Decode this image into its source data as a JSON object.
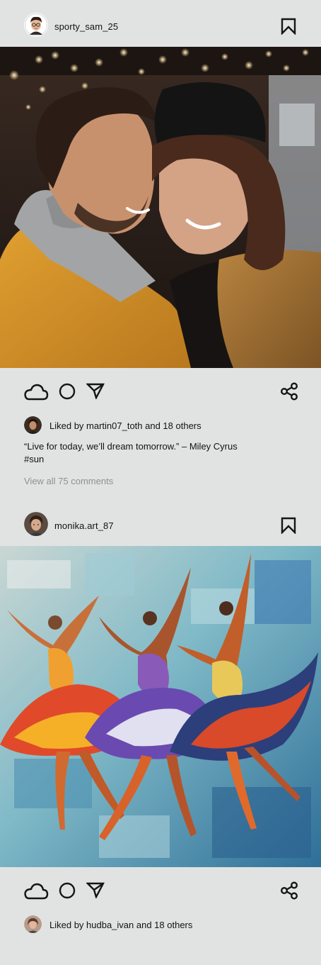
{
  "theme": {
    "background": "#e1e3e3",
    "icon_color": "#151515",
    "muted_text": "#8e9191"
  },
  "posts": [
    {
      "username": "sporty_sam_25",
      "image_alt": "Smiling couple in winter jackets under string lights",
      "likes_text": "Liked by martin07_toth and 18 others",
      "caption_line1": "“Live for today, we’ll dream tomorrow.” – Miley Cyrus",
      "caption_line2": "#sun",
      "comments_link": "View all 75 comments"
    },
    {
      "username": "monika.art_87",
      "image_alt": "Colorful palette-knife painting of three dancing ballerinas",
      "likes_text": "Liked by hudba_ivan and 18 others"
    }
  ],
  "icons": {
    "bookmark": "bookmark-icon",
    "like": "cloud-icon",
    "comment": "circle-icon",
    "send": "send-icon",
    "share": "share-icon"
  }
}
